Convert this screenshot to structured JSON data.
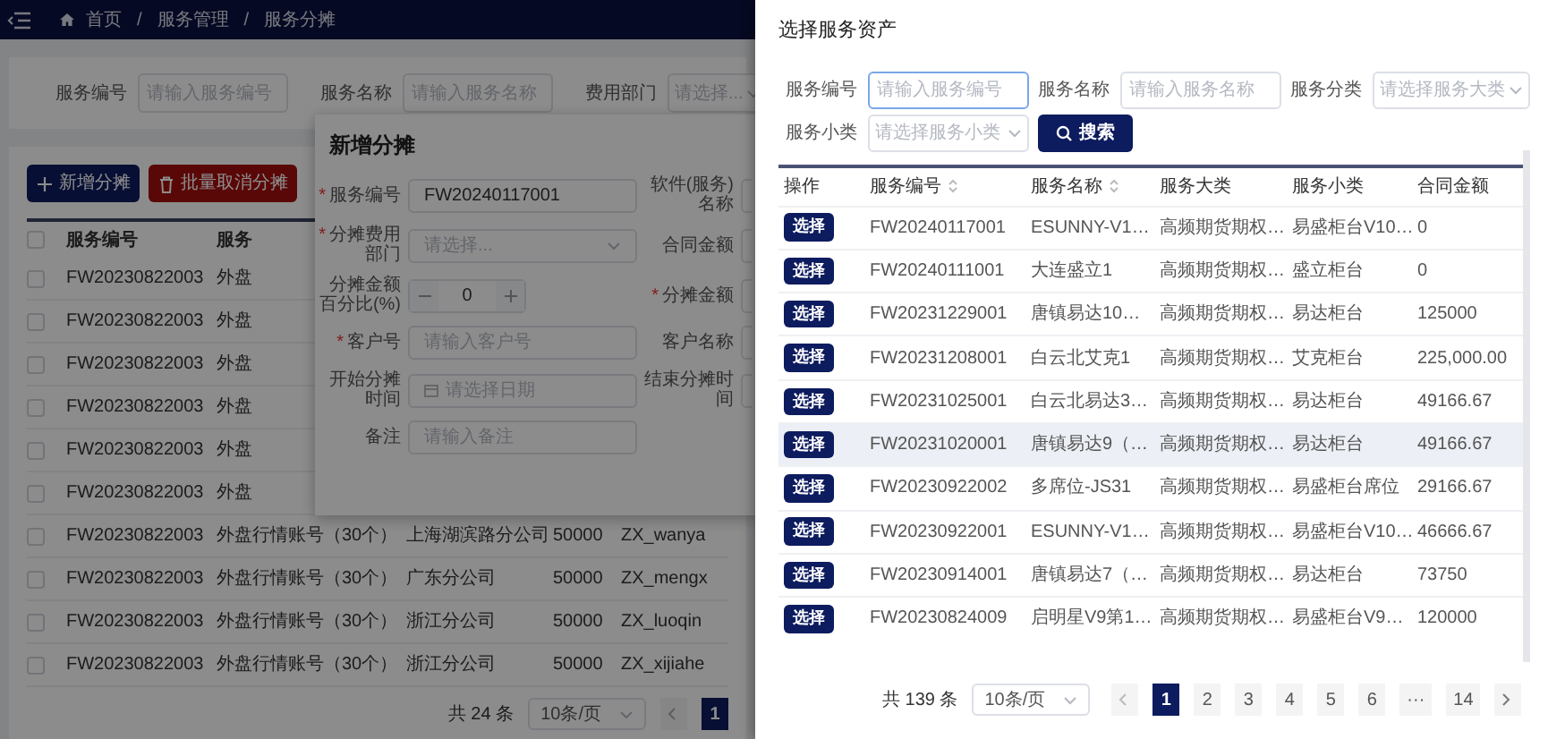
{
  "background_page": {
    "breadcrumb": {
      "separator": "/",
      "items": [
        "首页",
        "服务管理",
        "服务分摊"
      ]
    },
    "filters": [
      {
        "label": "服务编号",
        "placeholder": "请输入服务编号",
        "kind": "input"
      },
      {
        "label": "服务名称",
        "placeholder": "请输入服务名称",
        "kind": "input"
      },
      {
        "label": "费用部门",
        "placeholder": "请选择...",
        "kind": "select"
      }
    ],
    "buttons": [
      {
        "label": "新增分摊",
        "kind": "primary"
      },
      {
        "label": "批量取消分摊",
        "kind": "danger"
      }
    ],
    "table": {
      "header_checked": false,
      "columns": [
        "服务编号",
        "服务"
      ],
      "rows": [
        {
          "checked": false,
          "cells": [
            "FW20230822003",
            "外盘"
          ]
        },
        {
          "checked": false,
          "cells": [
            "FW20230822003",
            "外盘"
          ]
        },
        {
          "checked": false,
          "cells": [
            "FW20230822003",
            "外盘"
          ]
        },
        {
          "checked": false,
          "cells": [
            "FW20230822003",
            "外盘"
          ]
        },
        {
          "checked": false,
          "cells": [
            "FW20230822003",
            "外盘"
          ]
        },
        {
          "checked": false,
          "cells": [
            "FW20230822003",
            "外盘"
          ]
        },
        {
          "checked": false,
          "cells": [
            "FW20230822003",
            "外盘行情账号（30个）",
            "上海湖滨路分公司",
            "50000",
            "ZX_wanya"
          ]
        },
        {
          "checked": false,
          "cells": [
            "FW20230822003",
            "外盘行情账号（30个）",
            "广东分公司",
            "50000",
            "ZX_mengx"
          ]
        },
        {
          "checked": false,
          "cells": [
            "FW20230822003",
            "外盘行情账号（30个）",
            "浙江分公司",
            "50000",
            "ZX_luoqin"
          ]
        },
        {
          "checked": false,
          "cells": [
            "FW20230822003",
            "外盘行情账号（30个）",
            "浙江分公司",
            "50000",
            "ZX_xijiahe"
          ]
        }
      ]
    },
    "pagination": {
      "total": "共 24 条",
      "page_size": "10条/页",
      "pages": [
        {
          "label": "1",
          "selected": true
        }
      ]
    }
  },
  "dialog": {
    "title": "新增分摊",
    "rows": [
      {
        "left": {
          "label": "服务编号",
          "required_mark": "*",
          "kind": "input",
          "value": "FW20240117001"
        },
        "right": {
          "label": "软件(服务)名称"
        }
      },
      {
        "left": {
          "label": "分摊费用部门",
          "required_mark": "*",
          "kind": "select",
          "placeholder": "请选择..."
        },
        "right": {
          "label": "合同金额"
        }
      },
      {
        "left": {
          "label": "分摊金额百分比(%)",
          "kind": "number",
          "value": "0"
        },
        "right": {
          "label": "分摊金额",
          "required_mark": "*"
        }
      },
      {
        "left": {
          "label": "客户号",
          "required_mark": "*",
          "kind": "input",
          "placeholder": "请输入客户号"
        },
        "right": {
          "label": "客户名称"
        }
      },
      {
        "left": {
          "label": "开始分摊时间",
          "kind": "date",
          "placeholder": "请选择日期"
        },
        "right": {
          "label": "结束分摊时间"
        }
      },
      {
        "left": {
          "label": "备注",
          "kind": "input",
          "placeholder": "请输入备注"
        }
      }
    ]
  },
  "drawer": {
    "title": "选择服务资产",
    "filters": [
      {
        "label": "服务编号",
        "placeholder": "请输入服务编号",
        "kind": "input",
        "focused": true
      },
      {
        "label": "服务名称",
        "placeholder": "请输入服务名称",
        "kind": "input",
        "focused": false
      },
      {
        "label": "服务分类",
        "placeholder": "请选择服务大类",
        "kind": "select",
        "focused": false
      },
      {
        "label": "服务小类",
        "placeholder": "请选择服务小类",
        "kind": "select",
        "focused": false
      }
    ],
    "search_button": "搜索",
    "table": {
      "columns": [
        {
          "label": "操作",
          "sortable": false
        },
        {
          "label": "服务编号",
          "sortable": true
        },
        {
          "label": "服务名称",
          "sortable": true
        },
        {
          "label": "服务大类",
          "sortable": false
        },
        {
          "label": "服务小类",
          "sortable": false
        },
        {
          "label": "合同金额",
          "sortable": false
        }
      ],
      "rows": [
        {
          "hovered": false,
          "cells": [
            "选择",
            "FW20240117001",
            "ESUNNY-V1…",
            "高频期货期权…",
            "易盛柜台V10…",
            "0"
          ]
        },
        {
          "hovered": false,
          "cells": [
            "选择",
            "FW20240111001",
            "大连盛立1",
            "高频期货期权…",
            "盛立柜台",
            "0"
          ]
        },
        {
          "hovered": false,
          "cells": [
            "选择",
            "FW20231229001",
            "唐镇易达10…",
            "高频期货期权…",
            "易达柜台",
            "125000"
          ]
        },
        {
          "hovered": false,
          "cells": [
            "选择",
            "FW20231208001",
            "白云北艾克1",
            "高频期货期权…",
            "艾克柜台",
            "225,000.00"
          ]
        },
        {
          "hovered": false,
          "cells": [
            "选择",
            "FW20231025001",
            "白云北易达3…",
            "高频期货期权…",
            "易达柜台",
            "49166.67"
          ]
        },
        {
          "hovered": true,
          "cells": [
            "选择",
            "FW20231020001",
            "唐镇易达9（…",
            "高频期货期权…",
            "易达柜台",
            "49166.67"
          ]
        },
        {
          "hovered": false,
          "cells": [
            "选择",
            "FW20230922002",
            "多席位-JS31",
            "高频期货期权…",
            "易盛柜台席位",
            "29166.67"
          ]
        },
        {
          "hovered": false,
          "cells": [
            "选择",
            "FW20230922001",
            "ESUNNY-V1…",
            "高频期货期权…",
            "易盛柜台V10…",
            "46666.67"
          ]
        },
        {
          "hovered": false,
          "cells": [
            "选择",
            "FW20230914001",
            "唐镇易达7（…",
            "高频期货期权…",
            "易达柜台",
            "73750"
          ]
        },
        {
          "hovered": false,
          "cells": [
            "选择",
            "FW20230824009",
            "启明星V9第1…",
            "高频期货期权…",
            "易盛柜台V9…",
            "120000"
          ]
        }
      ]
    },
    "pagination": {
      "total": "共 139 条",
      "page_size": "10条/页",
      "pages": [
        {
          "label": "1",
          "selected": true
        },
        {
          "label": "2",
          "selected": false
        },
        {
          "label": "3",
          "selected": false
        },
        {
          "label": "4",
          "selected": false
        },
        {
          "label": "5",
          "selected": false
        },
        {
          "label": "6",
          "selected": false
        },
        {
          "label": "···",
          "selected": false
        },
        {
          "label": "14",
          "selected": false
        }
      ]
    }
  }
}
